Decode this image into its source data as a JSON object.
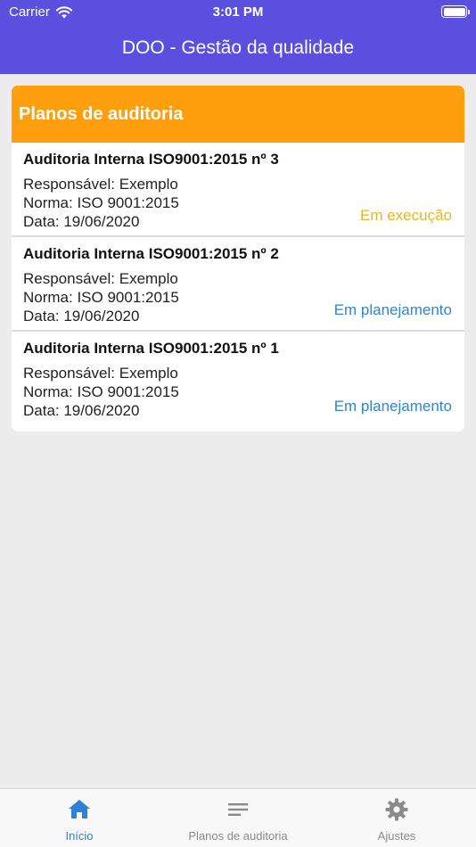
{
  "status_bar": {
    "carrier": "Carrier",
    "time": "3:01 PM"
  },
  "nav": {
    "title": "DOO - Gestão da qualidade"
  },
  "card": {
    "title": "Planos de auditoria",
    "items": [
      {
        "title": "Auditoria Interna ISO9001:2015 nº 3",
        "responsavel": "Responsável: Exemplo",
        "norma": "Norma: ISO 9001:2015",
        "data": "Data: 19/06/2020",
        "status": "Em execução"
      },
      {
        "title": "Auditoria Interna ISO9001:2015 nº 2",
        "responsavel": "Responsável: Exemplo",
        "norma": "Norma: ISO 9001:2015",
        "data": "Data: 19/06/2020",
        "status": "Em planejamento"
      },
      {
        "title": "Auditoria Interna ISO9001:2015 nº 1",
        "responsavel": "Responsável: Exemplo",
        "norma": "Norma: ISO 9001:2015",
        "data": "Data: 19/06/2020",
        "status": "Em planejamento"
      }
    ]
  },
  "tabs": [
    {
      "label": "Início",
      "icon": "home-icon",
      "active": true
    },
    {
      "label": "Planos de auditoria",
      "icon": "list-icon",
      "active": false
    },
    {
      "label": "Ajustes",
      "icon": "gear-icon",
      "active": false
    }
  ],
  "colors": {
    "header": "#5b4fe0",
    "card_header": "#ff9f0d",
    "status_exec": "#e4b81c",
    "status_plan": "#2f86c8",
    "tab_active": "#2f7fd8",
    "tab_inactive": "#8a8a8a"
  }
}
